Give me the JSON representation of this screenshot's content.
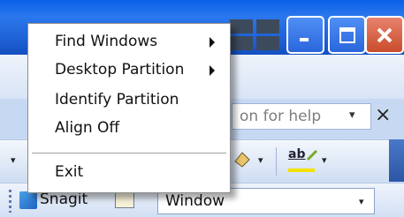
{
  "window": {
    "help_placeholder": "on for help",
    "help_close": "×",
    "snagit_label": "Snagit",
    "capture_target": "Window",
    "dropdown_arrow": "▾",
    "format_label": "ab",
    "colors": {
      "title_bar": "#1f62d6",
      "close_button": "#d0583a",
      "toolbar": "#d8e4f6"
    }
  },
  "context_menu": {
    "items": [
      {
        "label": "Find Windows",
        "has_submenu": true
      },
      {
        "label": "Desktop Partition",
        "has_submenu": true
      },
      {
        "label": "Identify Partition",
        "has_submenu": false
      },
      {
        "label": "Align Off",
        "has_submenu": false
      }
    ],
    "exit_label": "Exit"
  }
}
